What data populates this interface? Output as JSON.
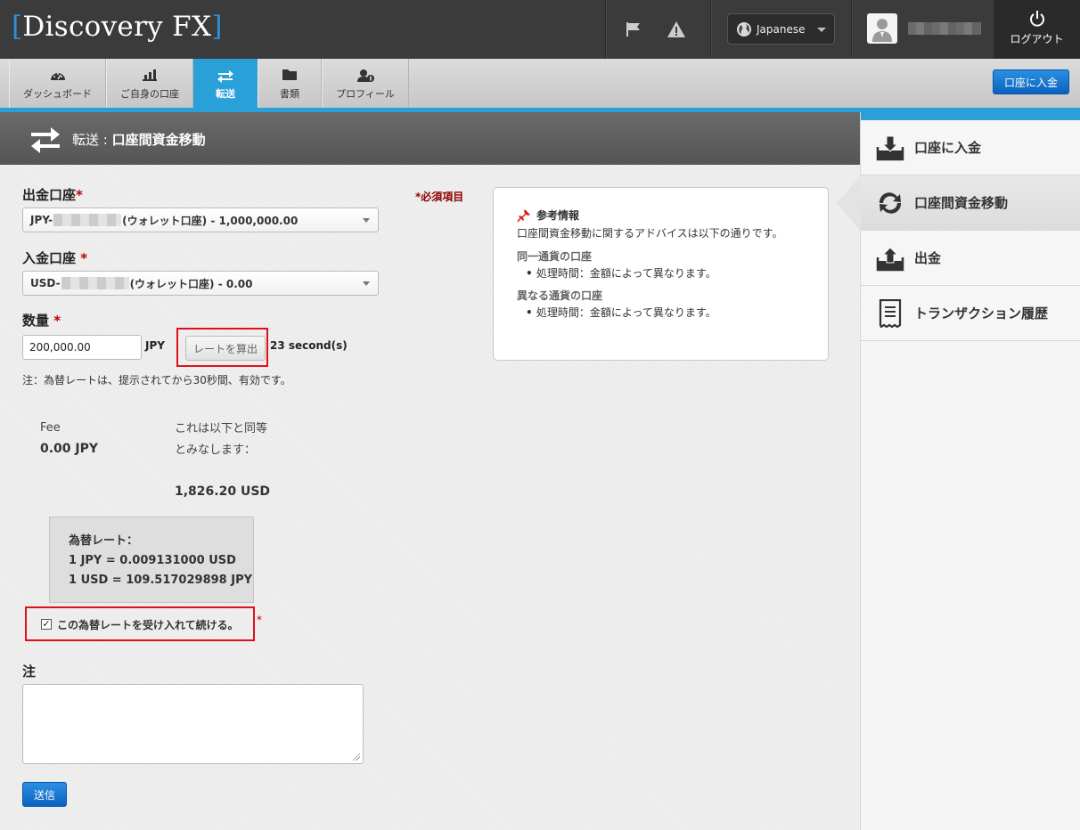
{
  "header": {
    "logo_main": "Discovery FX",
    "language": "Japanese",
    "logout_label": "ログアウト"
  },
  "nav": {
    "tabs": [
      {
        "label": "ダッシュボード",
        "icon": "dashboard-icon"
      },
      {
        "label": "ご自身の口座",
        "icon": "bar-chart-icon"
      },
      {
        "label": "転送",
        "icon": "transfer-icon",
        "active": true
      },
      {
        "label": "書類",
        "icon": "folder-icon"
      },
      {
        "label": "プロフィール",
        "icon": "profile-icon"
      }
    ],
    "deposit_button": "口座に入金"
  },
  "page": {
    "title_prefix": "転送 : ",
    "title_main": "口座間資金移動"
  },
  "form": {
    "from_label": "出金口座",
    "to_label": "入金口座 ",
    "required_star": "*",
    "required_note": "*必須項目",
    "from_prefix": "JPY-",
    "from_suffix": "(ウォレット口座) - 1,000,000.00",
    "to_prefix": "USD-",
    "to_suffix": "(ウォレット口座) - 0.00",
    "amount_label": "数量 ",
    "amount_value": "200,000.00",
    "amount_unit": "JPY",
    "calc_button": "レートを算出",
    "countdown": "23 second(s)",
    "rate_note": "注：為替レートは、提示されてから30秒間、有効です。",
    "fee_label": "Fee",
    "fee_value": "0.00 JPY",
    "equiv_label": "これは以下と同等とみなします：",
    "equiv_value": "1,826.20 USD",
    "rate_title": "為替レート：",
    "rate_line1": "1 JPY = 0.009131000 USD",
    "rate_line2": "1 USD = 109.517029898 JPY",
    "accept_label": "この為替レートを受け入れて続ける。",
    "memo_label": "注",
    "submit_label": "送信"
  },
  "info": {
    "heading": "参考情報",
    "intro": "口座間資金移動に関するアドバイスは以下の通りです。",
    "same_currency_title": "同一通貨の口座",
    "same_currency_item": "処理時間：金額によって異なります。",
    "diff_currency_title": "異なる通貨の口座",
    "diff_currency_item": "処理時間：金額によって異なります。"
  },
  "sidebar": {
    "items": [
      {
        "label": "口座に入金",
        "icon": "deposit-icon"
      },
      {
        "label": "口座間資金移動",
        "icon": "exchange-icon",
        "active": true
      },
      {
        "label": "出金",
        "icon": "withdraw-icon"
      },
      {
        "label": "トランザクション履歴",
        "icon": "receipt-icon"
      }
    ]
  },
  "colors": {
    "accent": "#2aa0d8",
    "button_blue": "#0a62c0",
    "highlight_red": "#e0101a"
  }
}
